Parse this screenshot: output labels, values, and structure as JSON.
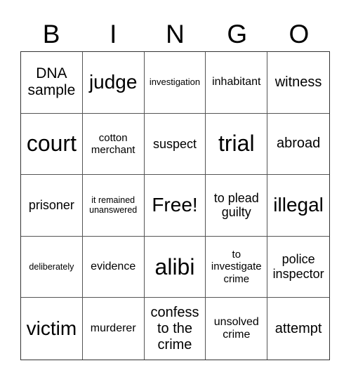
{
  "header": {
    "letters": [
      "B",
      "I",
      "N",
      "G",
      "O"
    ]
  },
  "cells": [
    [
      "DNA sample",
      "judge",
      "investigation",
      "inhabitant",
      "witness"
    ],
    [
      "court",
      "cotton merchant",
      "suspect",
      "trial",
      "abroad"
    ],
    [
      "prisoner",
      "it remained unanswered",
      "Free!",
      "to plead guilty",
      "illegal"
    ],
    [
      "deliberately",
      "evidence",
      "alibi",
      "to investigate crime",
      "police inspector"
    ],
    [
      "victim",
      "murderer",
      "confess to the crime",
      "unsolved crime",
      "attempt"
    ]
  ]
}
